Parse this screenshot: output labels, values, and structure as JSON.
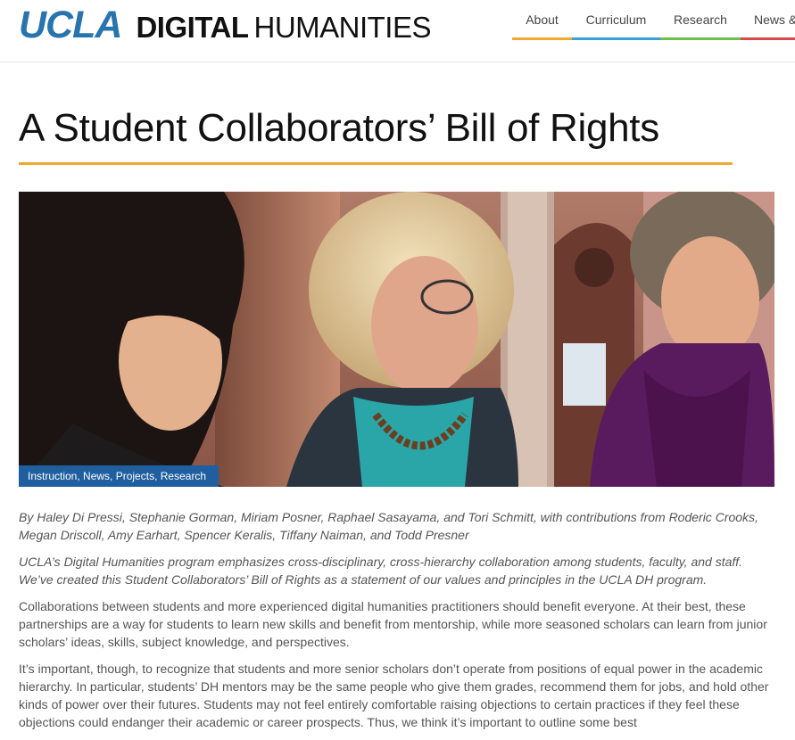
{
  "site": {
    "logo_ucla": "UCLA",
    "logo_digital": "DIGITAL",
    "logo_humanities": "HUMANITIES"
  },
  "nav": {
    "items": [
      {
        "label": "About"
      },
      {
        "label": "Curriculum"
      },
      {
        "label": "Research"
      },
      {
        "label": "News &"
      }
    ]
  },
  "colors": {
    "brand_blue": "#2774ae",
    "accent_gold": "#f0a830",
    "nav_blue": "#3a9fd6",
    "nav_green": "#6cbf4a",
    "nav_red": "#d54a4a",
    "category_bg": "#1f5fa0"
  },
  "article": {
    "title": "A Student Collaborators’ Bill of Rights",
    "categories": [
      "Instruction",
      "News",
      "Projects",
      "Research"
    ],
    "byline": "By Haley Di Pressi, Stephanie Gorman, Miriam Posner, Raphael Sasayama, and Tori Schmitt, with contributions from Roderic Crooks, Megan Driscoll, Amy Earhart, Spencer Keralis, Tiffany Naiman, and Todd Presner",
    "intro": "UCLA’s Digital Humanities program emphasizes cross-disciplinary, cross-hierarchy collaboration among students, faculty, and staff. We’ve created this Student Collaborators’ Bill of Rights as a statement of our values and principles in the UCLA DH program.",
    "paragraphs": [
      "Collaborations between students and more experienced digital humanities practitioners should benefit everyone. At their best, these partnerships are a way for students to learn new skills and benefit from mentorship, while more seasoned scholars can learn from junior scholars’ ideas, skills, subject knowledge, and perspectives.",
      "It’s important, though, to recognize that students and more senior scholars don’t operate from positions of equal power in the academic hierarchy. In particular, students’ DH mentors may be the same people who give them grades, recommend them for jobs, and hold other kinds of power over their futures. Students may not feel entirely comfortable raising objections to certain practices if they feel these objections could endanger their academic or career prospects. Thus, we think it’s important to outline some best"
    ]
  }
}
